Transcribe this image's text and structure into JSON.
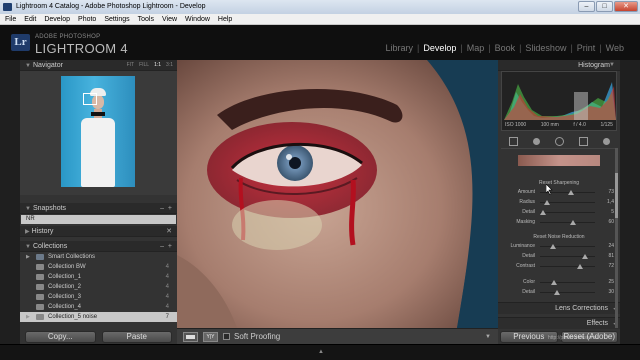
{
  "window": {
    "title": "Lightroom 4 Catalog - Adobe Photoshop Lightroom - Develop"
  },
  "menu": [
    "File",
    "Edit",
    "Develop",
    "Photo",
    "Settings",
    "Tools",
    "View",
    "Window",
    "Help"
  ],
  "identity": {
    "logo": "Lr",
    "small": "ADOBE PHOTOSHOP",
    "big": "LIGHTROOM 4"
  },
  "modules": [
    "Library",
    "Develop",
    "Map",
    "Book",
    "Slideshow",
    "Print",
    "Web"
  ],
  "active_module": "Develop",
  "left": {
    "navigator": {
      "title": "Navigator",
      "zoom": [
        "FIT",
        "FILL",
        "1:1",
        "3:1"
      ]
    },
    "snapshots": {
      "title": "Snapshots",
      "items": [
        "NR"
      ]
    },
    "history": {
      "title": "History"
    },
    "collections": {
      "title": "Collections",
      "items": [
        {
          "label": "Smart Collections",
          "count": ""
        },
        {
          "label": "Collection BW",
          "count": "4"
        },
        {
          "label": "Collection_1",
          "count": "4"
        },
        {
          "label": "Collection_2",
          "count": "4"
        },
        {
          "label": "Collection_3",
          "count": "4"
        },
        {
          "label": "Collection_4",
          "count": "4"
        },
        {
          "label": "Collection_5 noise",
          "count": "7"
        }
      ]
    },
    "buttons": {
      "copy": "Copy...",
      "paste": "Paste"
    }
  },
  "toolbar": {
    "soft_proofing": "Soft Proofing",
    "compare": "Y|Y"
  },
  "right": {
    "histogram": {
      "title": "Histogram",
      "iso": "ISO 1000",
      "focal": "100 mm",
      "aperture": "f / 4.0",
      "shutter": "1/125"
    },
    "sharpening": {
      "title": "Reset Sharpening",
      "rows": [
        {
          "label": "Amount",
          "value": "73",
          "level": 0.57
        },
        {
          "label": "Radius",
          "value": "1,4",
          "level": 0.13
        },
        {
          "label": "Detail",
          "value": "5",
          "level": 0.05
        },
        {
          "label": "Masking",
          "value": "60",
          "level": 0.6
        }
      ]
    },
    "noise": {
      "title": "Reset Noise Reduction",
      "rows": [
        {
          "label": "Luminance",
          "value": "24",
          "level": 0.24
        },
        {
          "label": "Detail",
          "value": "81",
          "level": 0.81
        },
        {
          "label": "Contrast",
          "value": "72",
          "level": 0.72
        },
        {
          "label": "Color",
          "value": "25",
          "level": 0.25
        },
        {
          "label": "Detail",
          "value": "30",
          "level": 0.3
        }
      ]
    },
    "sections": [
      "Lens Corrections",
      "Effects"
    ],
    "buttons": {
      "previous": "Previous",
      "reset": "Reset (Adobe)"
    }
  },
  "watermark": "http://photo-monster.ru"
}
